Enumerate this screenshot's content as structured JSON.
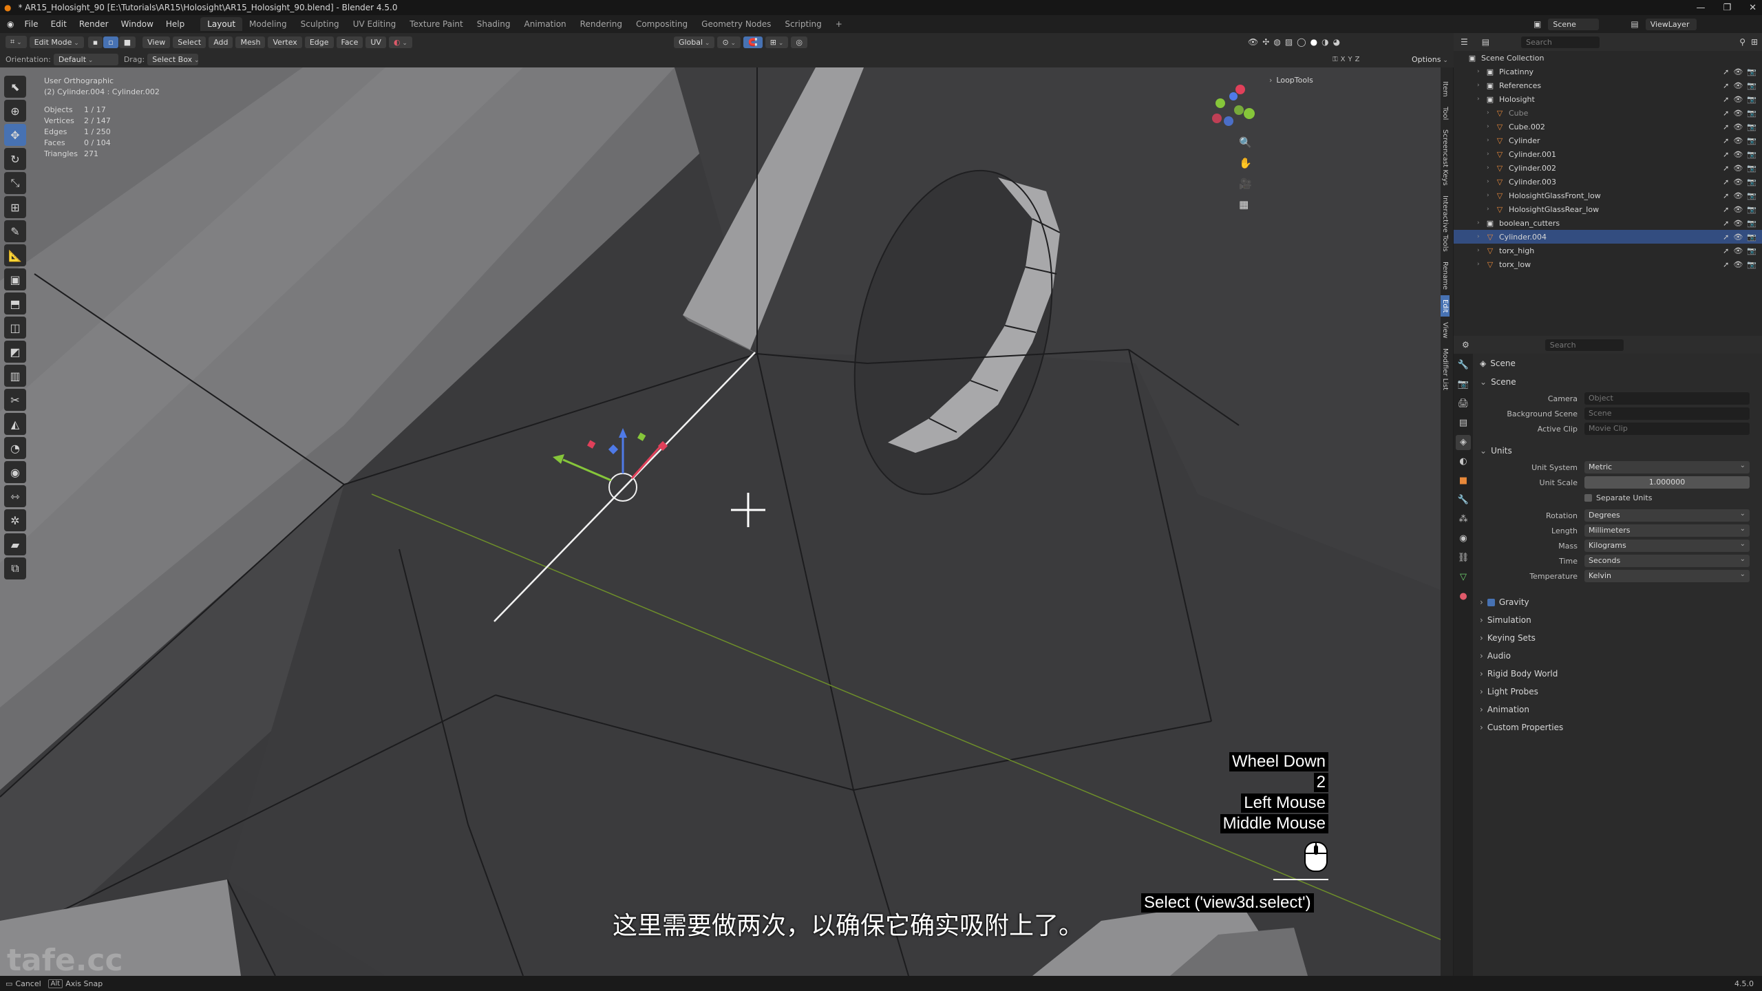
{
  "window": {
    "title": "* AR15_Holosight_90 [E:\\Tutorials\\AR15\\Holosight\\AR15_Holosight_90.blend] - Blender 4.5.0"
  },
  "menu": [
    "File",
    "Edit",
    "Render",
    "Window",
    "Help"
  ],
  "workspaces": [
    "Layout",
    "Modeling",
    "Sculpting",
    "UV Editing",
    "Texture Paint",
    "Shading",
    "Animation",
    "Rendering",
    "Compositing",
    "Geometry Nodes",
    "Scripting"
  ],
  "header": {
    "mode": "Edit Mode",
    "view": "View",
    "select": "Select",
    "add": "Add",
    "mesh": "Mesh",
    "vertex": "Vertex",
    "edge": "Edge",
    "face": "Face",
    "uv": "UV",
    "transform": "Global",
    "options": "Options"
  },
  "header2": {
    "orientation_label": "Orientation:",
    "orientation_value": "Default",
    "drag_label": "Drag:",
    "drag_value": "Select Box"
  },
  "stats": {
    "view": "User Orthographic",
    "object": "(2) Cylinder.004 : Cylinder.002",
    "rows": [
      {
        "k": "Objects",
        "v": "1 / 17"
      },
      {
        "k": "Vertices",
        "v": "2 / 147"
      },
      {
        "k": "Edges",
        "v": "1 / 250"
      },
      {
        "k": "Faces",
        "v": "0 / 104"
      },
      {
        "k": "Triangles",
        "v": "271"
      }
    ]
  },
  "sidebar_tabs": [
    "Item",
    "Tool",
    "Screencast Keys",
    "Interactive Tools",
    "Rename",
    "Edit",
    "View",
    "Modifier List"
  ],
  "looptools": "LoopTools",
  "overlay_keys": [
    "Wheel Down",
    "2",
    "Left Mouse",
    "Middle Mouse"
  ],
  "select_cmd": "Select ('view3d.select')",
  "subtitle": "这里需要做两次，以确保它确实吸附上了。",
  "watermark": "tafe.cc",
  "status": {
    "cancel": "Cancel",
    "alt": "Alt",
    "axis_snap": "Axis Snap",
    "version": "4.5.0"
  },
  "outliner": {
    "scene": "Scene",
    "viewlayer": "ViewLayer",
    "search": "Search",
    "root": "Scene Collection",
    "rows": [
      {
        "label": "Picatinny",
        "depth": 1,
        "type": "collection"
      },
      {
        "label": "References",
        "depth": 1,
        "type": "collection"
      },
      {
        "label": "Holosight",
        "depth": 1,
        "type": "collection"
      },
      {
        "label": "Cube",
        "depth": 2,
        "type": "mesh",
        "dim": true
      },
      {
        "label": "Cube.002",
        "depth": 2,
        "type": "mesh"
      },
      {
        "label": "Cylinder",
        "depth": 2,
        "type": "mesh"
      },
      {
        "label": "Cylinder.001",
        "depth": 2,
        "type": "mesh"
      },
      {
        "label": "Cylinder.002",
        "depth": 2,
        "type": "mesh"
      },
      {
        "label": "Cylinder.003",
        "depth": 2,
        "type": "mesh"
      },
      {
        "label": "HolosightGlassFront_low",
        "depth": 2,
        "type": "mesh"
      },
      {
        "label": "HolosightGlassRear_low",
        "depth": 2,
        "type": "mesh"
      },
      {
        "label": "boolean_cutters",
        "depth": 1,
        "type": "collection"
      },
      {
        "label": "Cylinder.004",
        "depth": 1,
        "type": "mesh",
        "selected": true
      },
      {
        "label": "torx_high",
        "depth": 1,
        "type": "mesh"
      },
      {
        "label": "torx_low",
        "depth": 1,
        "type": "mesh"
      }
    ]
  },
  "properties": {
    "search": "Search",
    "context": "Scene",
    "scene_section": "Scene",
    "camera_label": "Camera",
    "camera_ph": "Object",
    "bg_label": "Background Scene",
    "bg_ph": "Scene",
    "clip_label": "Active Clip",
    "clip_ph": "Movie Clip",
    "units_section": "Units",
    "unit_system_label": "Unit System",
    "unit_system": "Metric",
    "unit_scale_label": "Unit Scale",
    "unit_scale": "1.000000",
    "separate_units": "Separate Units",
    "rotation_label": "Rotation",
    "rotation": "Degrees",
    "length_label": "Length",
    "length": "Millimeters",
    "mass_label": "Mass",
    "mass": "Kilograms",
    "time_label": "Time",
    "time": "Seconds",
    "temp_label": "Temperature",
    "temp": "Kelvin",
    "panels": [
      "Gravity",
      "Simulation",
      "Keying Sets",
      "Audio",
      "Rigid Body World",
      "Light Probes",
      "Animation",
      "Custom Properties"
    ]
  },
  "colors": {
    "accent": "#4772b3",
    "viewport": "#3b3b3d",
    "selected_row": "#334d80"
  }
}
